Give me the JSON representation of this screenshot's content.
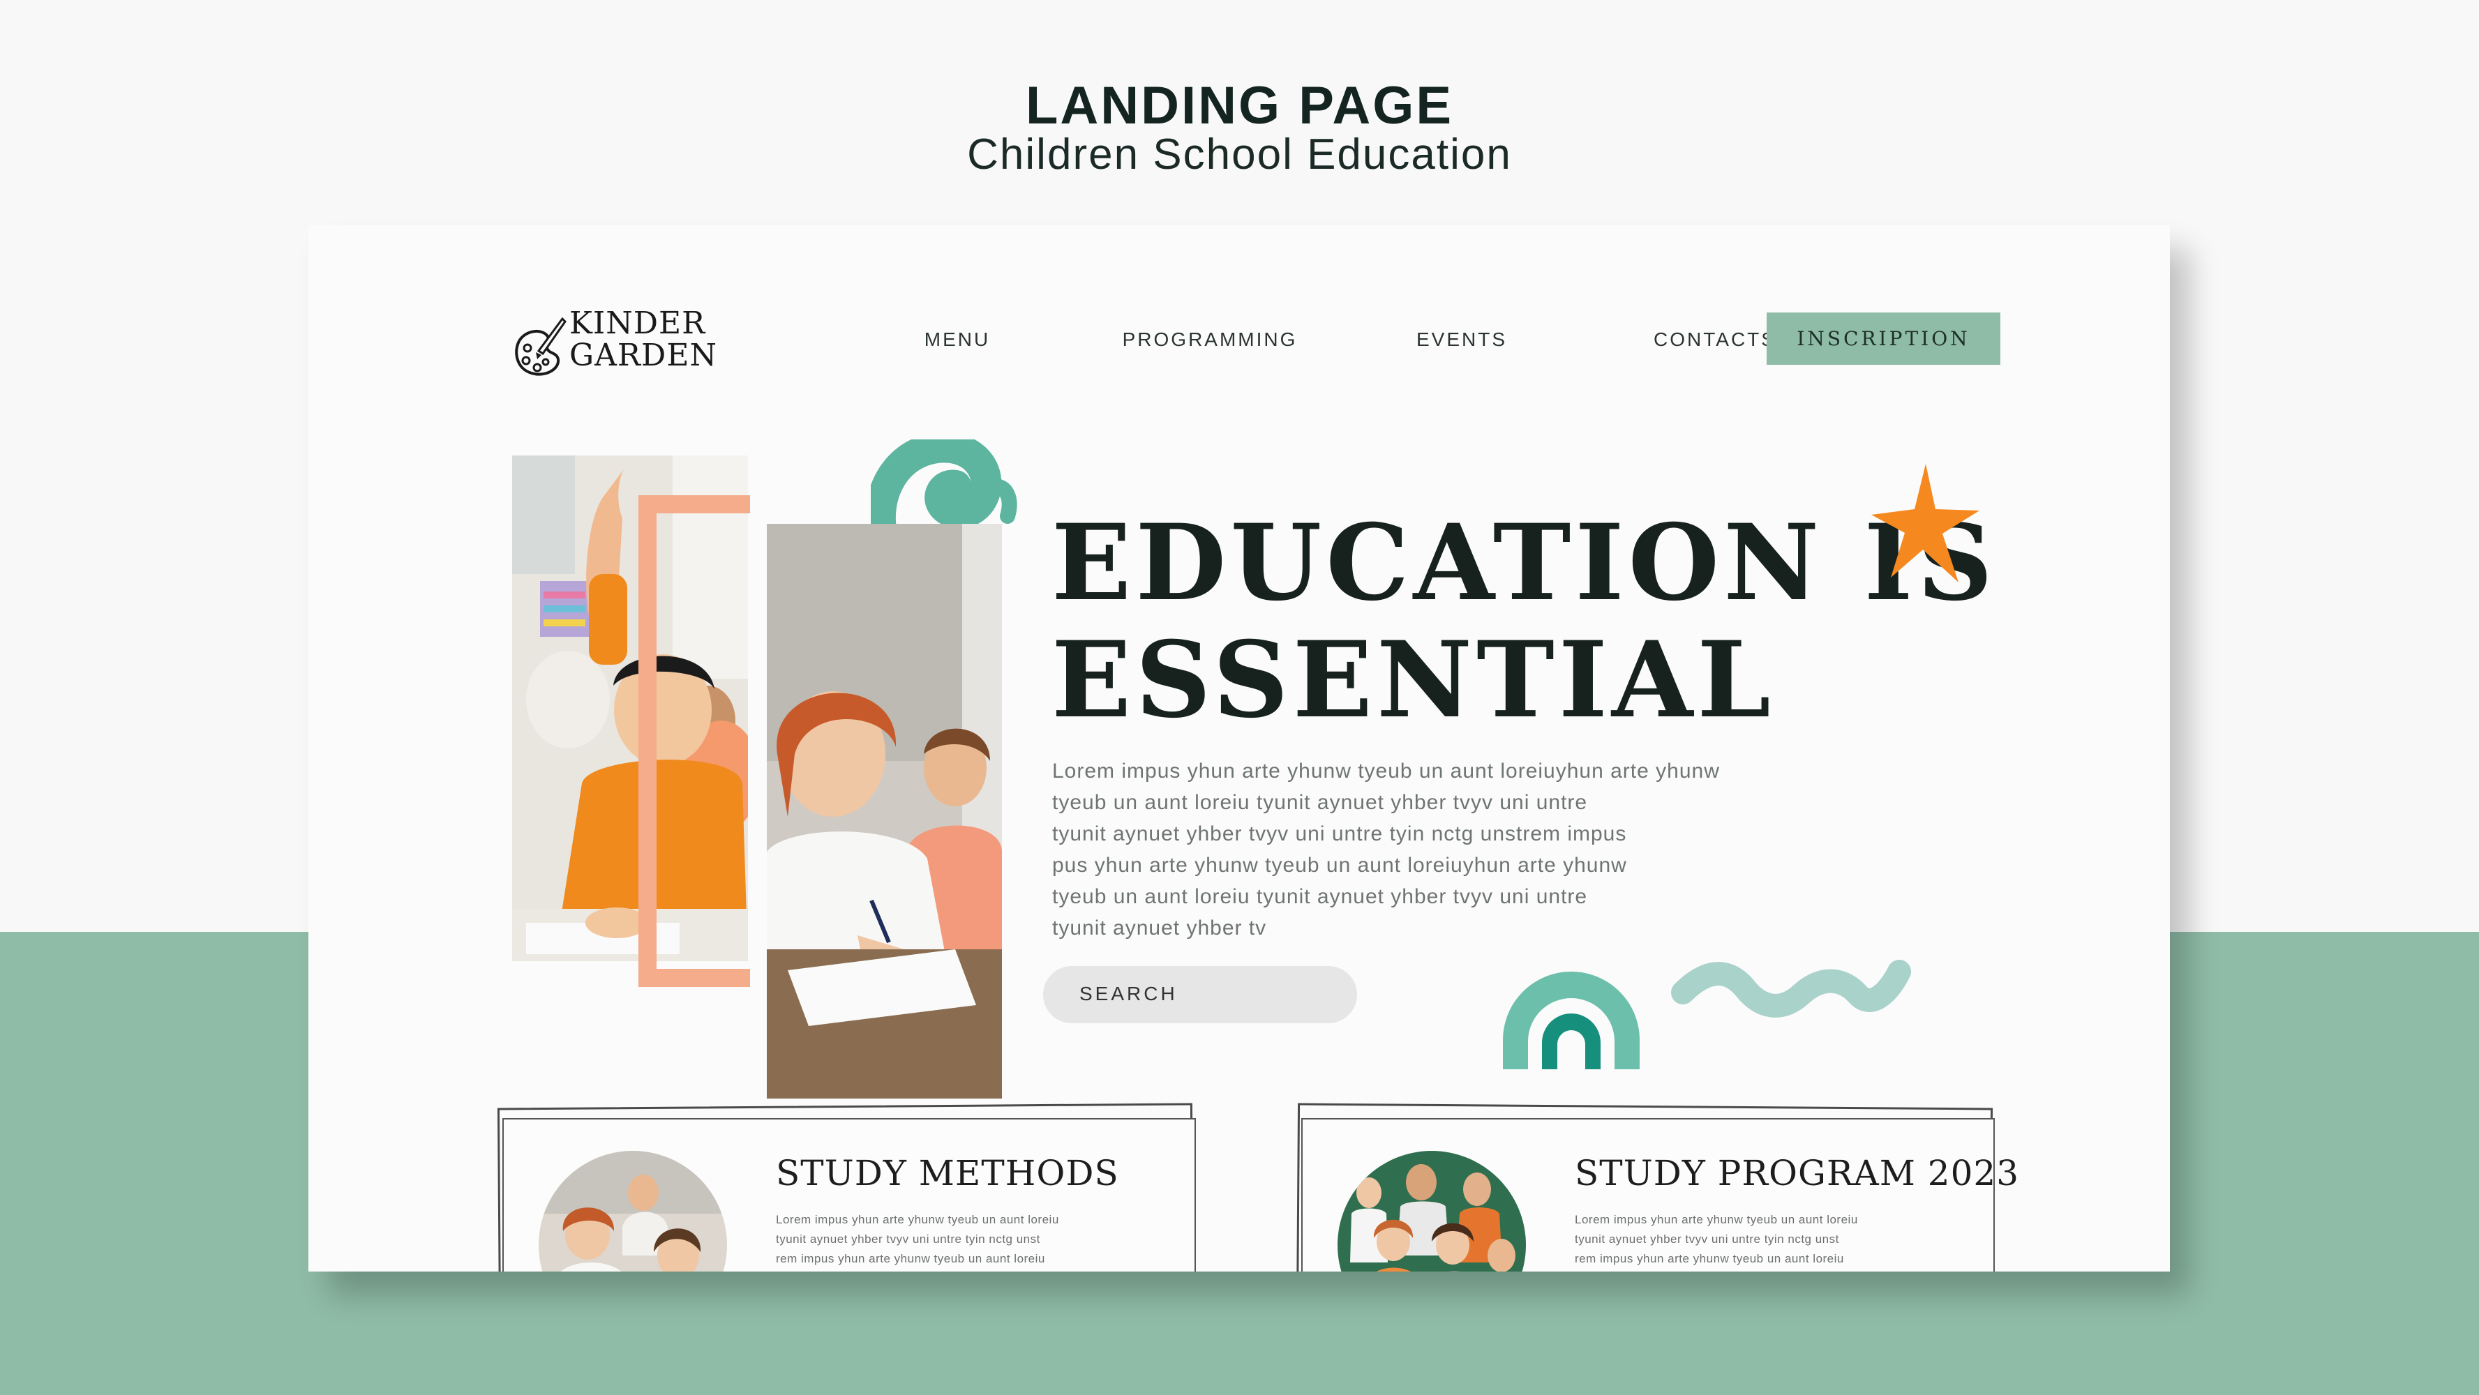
{
  "header": {
    "title": "LANDING PAGE",
    "subtitle": "Children School Education"
  },
  "colors": {
    "accent_green": "#8fbca7",
    "accent_teal": "#5db5a0",
    "accent_orange": "#f5891f",
    "accent_salmon": "#f5ac8b",
    "ink": "#17221f"
  },
  "logo": {
    "line1": "KINDER",
    "line2": "GARDEN",
    "icon": "paint-palette-icon"
  },
  "nav": {
    "items": [
      "MENU",
      "PROGRAMMING",
      "EVENTS",
      "CONTACTS"
    ],
    "cta_label": "INSCRIPTION"
  },
  "hero": {
    "headline_line1": "EDUCATION IS",
    "headline_line2": "ESSENTIAL",
    "body": "Lorem impus yhun arte yhunw tyeub un aunt loreiuyhun arte yhunw\ntyeub un aunt  loreiu tyunit aynuet yhber tvyv uni untre\ntyunit aynuet yhber tvyv uni untre tyin nctg unstrem impus\npus yhun arte yhunw tyeub un aunt loreiuyhun arte yhunw\ntyeub un aunt  loreiu tyunit aynuet yhber tvyv uni untre\ntyunit aynuet yhber tv",
    "search_label": "SEARCH",
    "decor": [
      "swirl-icon",
      "star-icon",
      "rainbow-icon",
      "wave-icon"
    ]
  },
  "cards": [
    {
      "title": "STUDY METHODS",
      "text": "Lorem impus yhun arte yhunw tyeub un aunt loreiu\ntyunit aynuet yhber tvyv uni untre tyin nctg unst\nrem impus yhun arte yhunw tyeub un aunt loreiu\ntyunit aynuet yhber tvyv uni untre"
    },
    {
      "title": "STUDY PROGRAM 2023",
      "text": "Lorem impus yhun arte yhunw tyeub un aunt loreiu\ntyunit aynuet yhber tvyv uni untre tyin nctg unst\nrem impus yhun arte yhunw tyeub un aunt loreiu\ntyunit aynuet yhber tvyv uni untre"
    }
  ]
}
